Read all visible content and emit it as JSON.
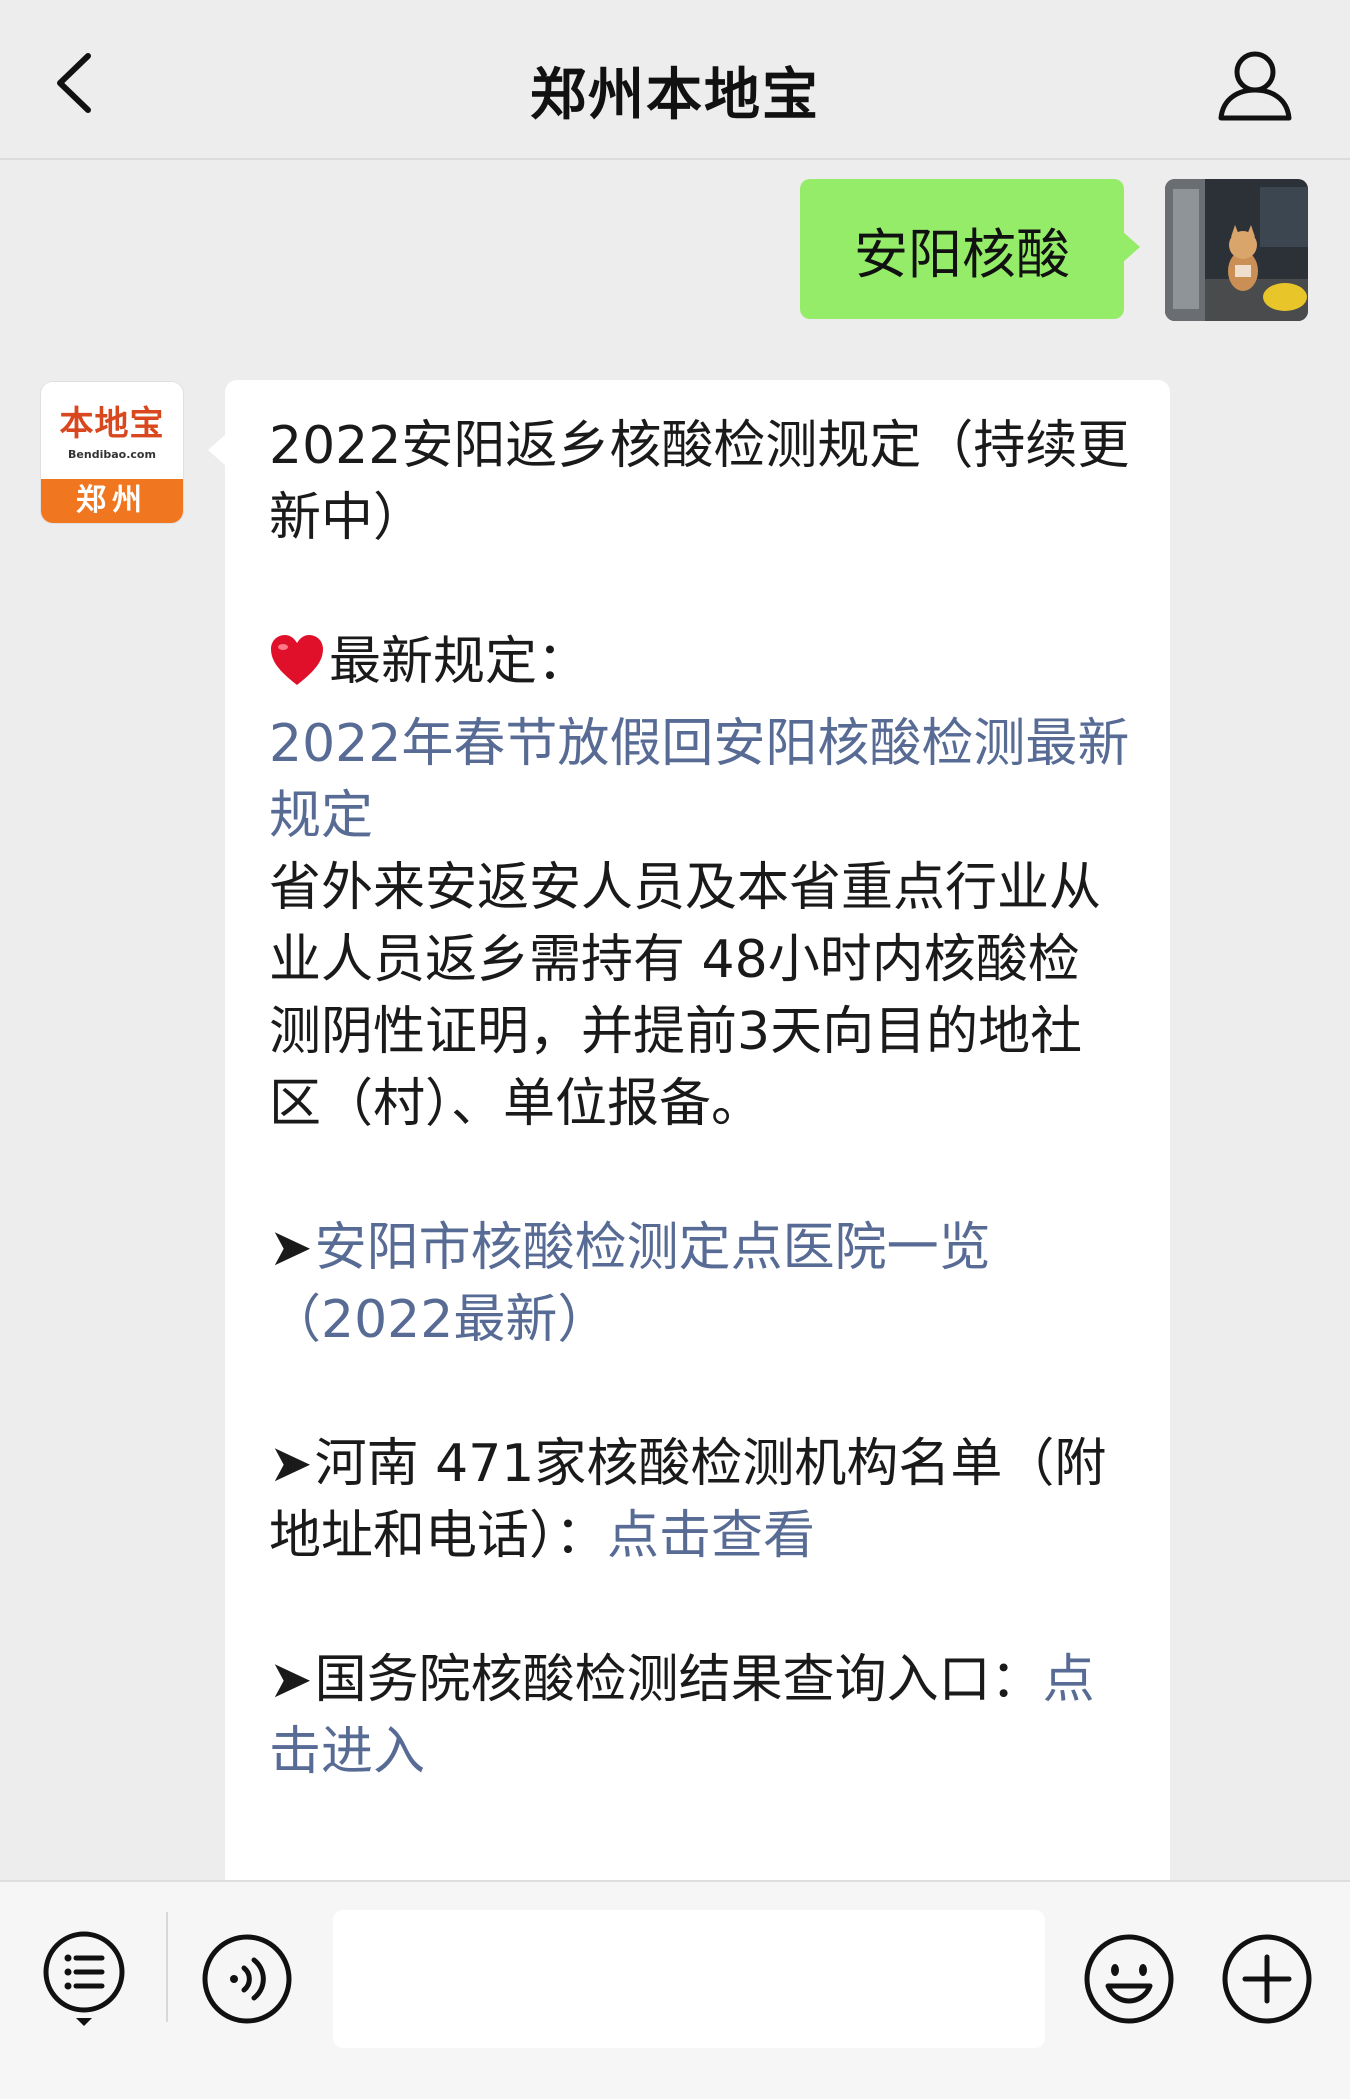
{
  "header": {
    "title": "郑州本地宝",
    "back_icon": "chevron-left-icon",
    "profile_icon": "person-icon"
  },
  "outgoing_message": {
    "text": "安阳核酸",
    "bubble_color": "#95ec69"
  },
  "official_account": {
    "logo_text": "本地宝",
    "logo_domain": "Bendibao.com",
    "city": "郑州",
    "accent_color": "#f0761f"
  },
  "incoming_message": {
    "headline": "2022安阳返乡核酸检测规定（持续更新中）",
    "latest_label": "最新规定：",
    "latest_link": "2022年春节放假回安阳核酸检测最新规定",
    "body": "省外来安返安人员及本省重点行业从业人员返乡需持有 48小时内核酸检测阴性证明，并提前3天向目的地社区（村）、单位报备。",
    "item1_arrow": "➤",
    "item1_link": "安阳市核酸检测定点医院一览（2022最新）",
    "item2_arrow": "➤",
    "item2_text": "河南 471家核酸检测机构名单（附地址和电话）：",
    "item2_link": "点击查看",
    "item3_arrow": "➤",
    "item3_text": "国务院核酸检测结果查询入口：",
    "item3_link": "点击进入",
    "link_color": "#576b95"
  },
  "input_bar": {
    "menu_icon": "list-menu-icon",
    "voice_icon": "voice-icon",
    "input_value": "",
    "emoji_icon": "smiley-icon",
    "plus_icon": "plus-icon"
  }
}
